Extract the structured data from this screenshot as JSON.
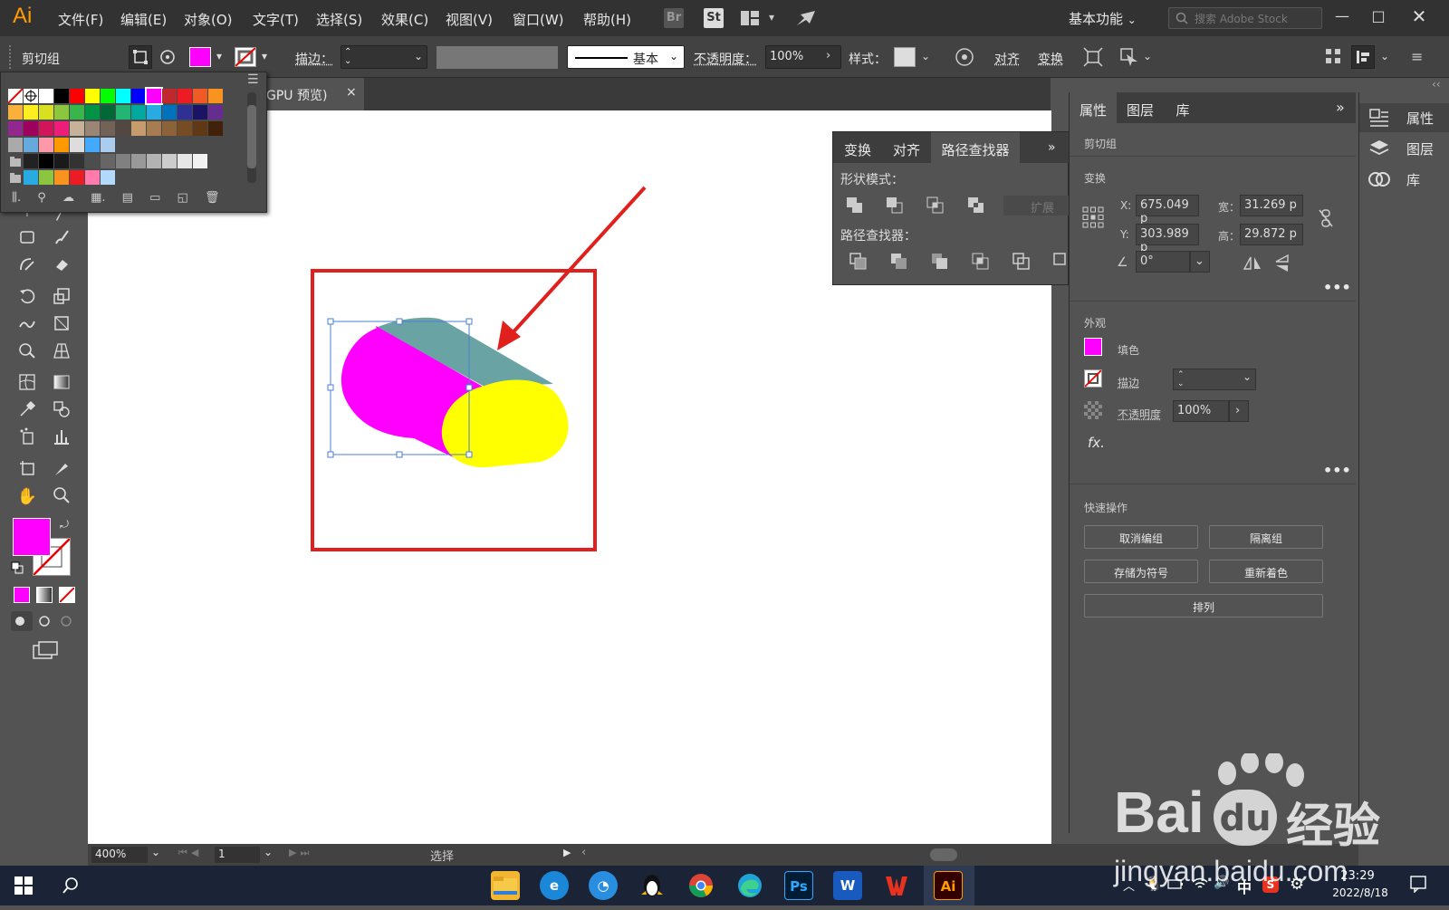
{
  "app": {
    "logo": "Ai",
    "accent": "#ff9a00"
  },
  "menu": [
    "文件(F)",
    "编辑(E)",
    "对象(O)",
    "文字(T)",
    "选择(S)",
    "效果(C)",
    "视图(V)",
    "窗口(W)",
    "帮助(H)"
  ],
  "topbar": {
    "br": "Br",
    "st": "St",
    "workspace": "基本功能",
    "search_placeholder": "搜索 Adobe Stock"
  },
  "control": {
    "selection_type": "剪切组",
    "fill_color": "#ff00ff",
    "stroke_label": "描边：",
    "brush_label": "基本",
    "opacity_label": "不透明度：",
    "opacity_value": "100%",
    "style_label": "样式：",
    "align_label": "对齐",
    "transform_label": "变换"
  },
  "document_tab": {
    "title": "GPU 预览)",
    "close": "×"
  },
  "pathfinder_panel": {
    "tabs": [
      "变换",
      "对齐",
      "路径查找器"
    ],
    "active_tab": "路径查找器",
    "shape_modes_label": "形状模式：",
    "expand_label": "扩展",
    "pathfinders_label": "路径查找器："
  },
  "properties_panel": {
    "tabs": [
      "属性",
      "图层",
      "库"
    ],
    "active_tab": "属性",
    "selection_type": "剪切组",
    "transform_title": "变换",
    "x_label": "X:",
    "x_value": "675.049 p",
    "y_label": "Y:",
    "y_value": "303.989 p",
    "w_label": "宽：",
    "w_value": "31.269 p",
    "h_label": "高：",
    "h_value": "29.872 p",
    "angle_value": "0°",
    "appearance_title": "外观",
    "fill_label": "填色",
    "stroke_label": "描边",
    "opacity_label": "不透明度",
    "opacity_value": "100%",
    "fx_label": "fx.",
    "quick_actions_title": "快速操作",
    "buttons": [
      "取消编组",
      "隔离组",
      "存储为符号",
      "重新着色",
      "排列"
    ]
  },
  "dock": [
    "属性",
    "图层",
    "库"
  ],
  "statusbar": {
    "zoom": "400%",
    "page": "1",
    "mode": "选择"
  },
  "taskbar": {
    "time": "23:29",
    "date": "2022/8/18",
    "ime": "中",
    "ps": "Ps",
    "ai": "Ai",
    "word": "W"
  },
  "watermark": {
    "brand": "Bai",
    "du": "du",
    "suffix": "经验",
    "url": "jingyan.baidu.com"
  },
  "colors": {
    "magenta": "#ff00ff",
    "yellow": "#ffff00",
    "teal": "#6aa3a3",
    "annotation_red": "#e0201c",
    "selection_blue": "#4a7fd6"
  }
}
